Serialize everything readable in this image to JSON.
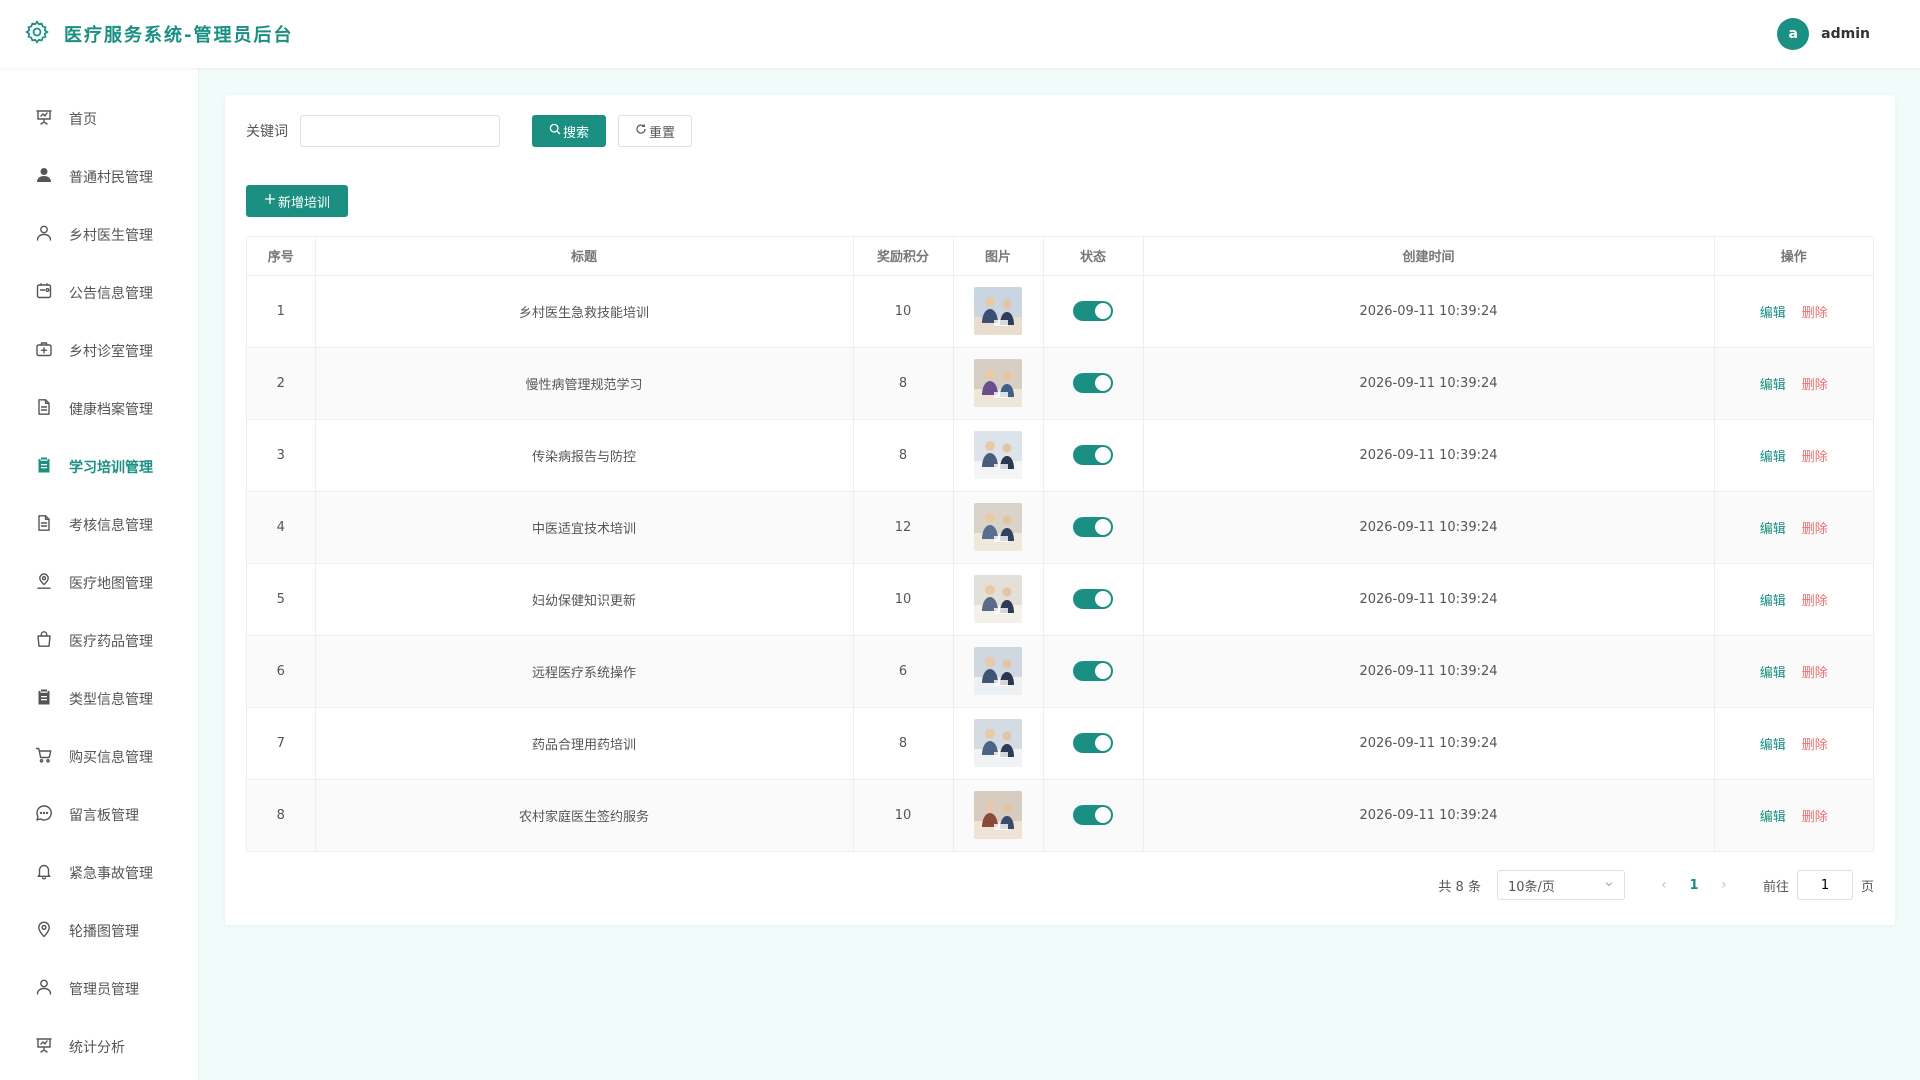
{
  "header": {
    "title": "医疗服务系统-管理员后台",
    "logo_icon": "gear-icon",
    "avatar_letter": "a",
    "username": "admin"
  },
  "sidebar": {
    "items": [
      {
        "label": "首页",
        "icon": "presentation-icon"
      },
      {
        "label": "普通村民管理",
        "icon": "user-filled-icon"
      },
      {
        "label": "乡村医生管理",
        "icon": "user-icon"
      },
      {
        "label": "公告信息管理",
        "icon": "notice-icon"
      },
      {
        "label": "乡村诊室管理",
        "icon": "first-aid-icon"
      },
      {
        "label": "健康档案管理",
        "icon": "document-icon"
      },
      {
        "label": "学习培训管理",
        "icon": "clipboard-icon",
        "active": true
      },
      {
        "label": "考核信息管理",
        "icon": "document-icon"
      },
      {
        "label": "医疗地图管理",
        "icon": "map-location-icon"
      },
      {
        "label": "医疗药品管理",
        "icon": "shopping-bag-icon"
      },
      {
        "label": "类型信息管理",
        "icon": "clipboard-icon"
      },
      {
        "label": "购买信息管理",
        "icon": "cart-icon"
      },
      {
        "label": "留言板管理",
        "icon": "chat-icon"
      },
      {
        "label": "紧急事故管理",
        "icon": "bell-icon"
      },
      {
        "label": "轮播图管理",
        "icon": "location-icon"
      },
      {
        "label": "管理员管理",
        "icon": "user-icon"
      },
      {
        "label": "统计分析",
        "icon": "presentation-icon"
      }
    ]
  },
  "search": {
    "label": "关键词",
    "value": "",
    "placeholder": "",
    "search_button": "搜索",
    "reset_button": "重置"
  },
  "toolbar": {
    "add_button": "新增培训"
  },
  "table": {
    "columns": [
      "序号",
      "标题",
      "奖励积分",
      "图片",
      "状态",
      "创建时间",
      "操作"
    ],
    "rows": [
      {
        "index": "1",
        "title": "乡村医生急救技能培训",
        "points": "10",
        "status": true,
        "created": "2026-09-11 10:39:24"
      },
      {
        "index": "2",
        "title": "慢性病管理规范学习",
        "points": "8",
        "status": true,
        "created": "2026-09-11 10:39:24"
      },
      {
        "index": "3",
        "title": "传染病报告与防控",
        "points": "8",
        "status": true,
        "created": "2026-09-11 10:39:24"
      },
      {
        "index": "4",
        "title": "中医适宜技术培训",
        "points": "12",
        "status": true,
        "created": "2026-09-11 10:39:24"
      },
      {
        "index": "5",
        "title": "妇幼保健知识更新",
        "points": "10",
        "status": true,
        "created": "2026-09-11 10:39:24"
      },
      {
        "index": "6",
        "title": "远程医疗系统操作",
        "points": "6",
        "status": true,
        "created": "2026-09-11 10:39:24"
      },
      {
        "index": "7",
        "title": "药品合理用药培训",
        "points": "8",
        "status": true,
        "created": "2026-09-11 10:39:24"
      },
      {
        "index": "8",
        "title": "农村家庭医生签约服务",
        "points": "10",
        "status": true,
        "created": "2026-09-11 10:39:24"
      }
    ],
    "edit_label": "编辑",
    "delete_label": "删除"
  },
  "pagination": {
    "total_text": "共 8 条",
    "page_size": "10条/页",
    "current_page": "1",
    "goto_label": "前往",
    "goto_value": "1",
    "goto_suffix": "页"
  },
  "colors": {
    "accent": "#1a8f82",
    "danger": "#f56c6c",
    "page_bg": "#f1fbf9"
  }
}
